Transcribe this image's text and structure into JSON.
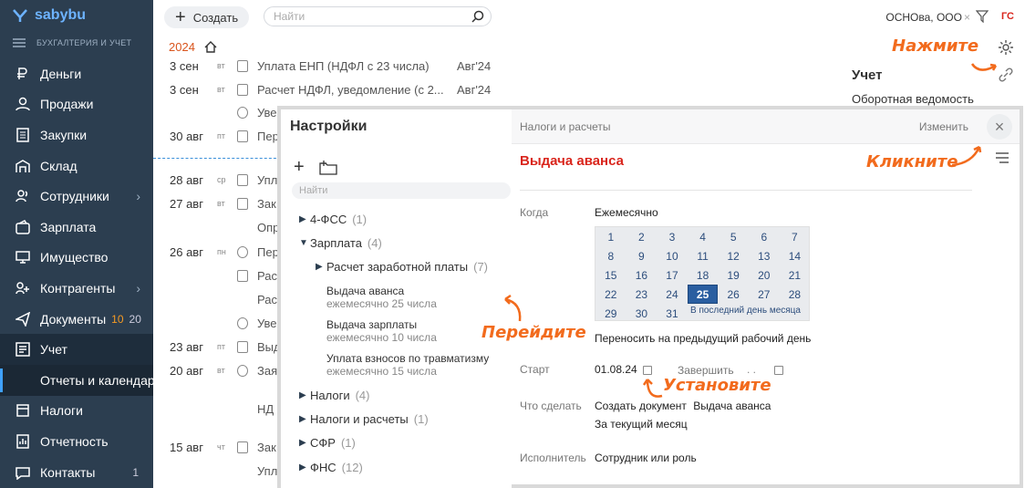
{
  "app": {
    "logo_text": "sabybu",
    "section": "БУХГАЛТЕРИЯ И УЧЕТ"
  },
  "nav": [
    {
      "label": "Деньги",
      "icon": "ruble-icon"
    },
    {
      "label": "Продажи",
      "icon": "user-icon"
    },
    {
      "label": "Закупки",
      "icon": "document-icon"
    },
    {
      "label": "Склад",
      "icon": "warehouse-icon"
    },
    {
      "label": "Сотрудники",
      "icon": "staff-icon",
      "arrow": "›"
    },
    {
      "label": "Зарплата",
      "icon": "wallet-icon"
    },
    {
      "label": "Имущество",
      "icon": "monitor-icon"
    },
    {
      "label": "Контрагенты",
      "icon": "contragents-icon",
      "arrow": "›"
    },
    {
      "label": "Документы",
      "icon": "send-icon",
      "count1": "10",
      "count2": "20"
    },
    {
      "label": "Учет",
      "icon": "accounting-icon"
    },
    {
      "label": "Отчеты и календарь"
    },
    {
      "label": "Налоги",
      "icon": "taxes-icon"
    },
    {
      "label": "Отчетность",
      "icon": "reporting-icon"
    },
    {
      "label": "Контакты",
      "icon": "contacts-icon",
      "count": "1"
    }
  ],
  "topbar": {
    "create_label": "Создать",
    "search_placeholder": "Найти",
    "org": "ОСНОва, ООО",
    "user": "ГС"
  },
  "year": "2024",
  "hints": {
    "press": "Нажмите",
    "click": "Кликните",
    "go": "Перейдите",
    "set": "Установите"
  },
  "feed": [
    {
      "d": "3 сен",
      "w": "вт",
      "t": "Уплата ЕНП (НДФЛ с 23 числа)",
      "m": "Авг'24"
    },
    {
      "d": "3 сен",
      "w": "вт",
      "t": "Расчет НДФЛ, уведомление (с 2...",
      "m": "Авг'24"
    },
    {
      "d": "",
      "w": "",
      "t": "Уве"
    },
    {
      "d": "30 авг",
      "w": "пт",
      "t": "Пер"
    },
    {
      "d": "28 авг",
      "w": "ср",
      "t": "Упл"
    },
    {
      "d": "27 авг",
      "w": "вт",
      "t": "Зак"
    },
    {
      "d": "",
      "w": "",
      "t": "Опр"
    },
    {
      "d": "26 авг",
      "w": "пн",
      "t": "Пер"
    },
    {
      "d": "",
      "w": "",
      "t": "Рас"
    },
    {
      "d": "",
      "w": "",
      "t": "Рас"
    },
    {
      "d": "",
      "w": "",
      "t": "Уве"
    },
    {
      "d": "23 авг",
      "w": "пт",
      "t": "Выд"
    },
    {
      "d": "20 авг",
      "w": "вт",
      "t": "Зая"
    },
    {
      "d": "",
      "w": "",
      "t": "НД"
    },
    {
      "d": "15 авг",
      "w": "чт",
      "t": "Зак"
    },
    {
      "d": "",
      "w": "",
      "t": "Упл"
    }
  ],
  "right_panel": {
    "title": "Учет",
    "sub": "Оборотная ведомость"
  },
  "settings": {
    "title": "Настройки",
    "search_placeholder": "Найти",
    "tree": [
      {
        "label": "4-ФСС",
        "count": "(1)"
      },
      {
        "label": "Зарплата",
        "count": "(4)"
      },
      {
        "label": "Расчет заработной платы",
        "count": "(7)"
      }
    ],
    "items": [
      {
        "title": "Выдача аванса",
        "sub": "ежемесячно 25 числа"
      },
      {
        "title": "Выдача зарплаты",
        "sub": "ежемесячно 10 числа"
      },
      {
        "title": "Уплата взносов по травматизму",
        "sub": "ежемесячно 15 числа"
      }
    ],
    "tree2": [
      {
        "label": "Налоги",
        "count": "(4)"
      },
      {
        "label": "Налоги и расчеты",
        "count": "(1)"
      },
      {
        "label": "СФР",
        "count": "(1)"
      },
      {
        "label": "ФНС",
        "count": "(12)"
      }
    ]
  },
  "detail": {
    "breadcrumb": "Налоги и расчеты",
    "edit": "Изменить",
    "title": "Выдача аванса",
    "when_label": "Когда",
    "when_value": "Ежемесячно",
    "days": [
      "1",
      "2",
      "3",
      "4",
      "5",
      "6",
      "7",
      "8",
      "9",
      "10",
      "11",
      "12",
      "13",
      "14",
      "15",
      "16",
      "17",
      "18",
      "19",
      "20",
      "21",
      "22",
      "23",
      "24",
      "25",
      "26",
      "27",
      "28",
      "29",
      "30",
      "31"
    ],
    "selected_day": "25",
    "last_day": "В последний день месяца",
    "transfer": "Переносить на предыдущий рабочий день",
    "start_label": "Старт",
    "start_value": "01.08.24",
    "finish_label": "Завершить",
    "finish_value": ". .",
    "todo_label": "Что сделать",
    "todo_value": "Создать документ",
    "todo_doc": "Выдача аванса",
    "todo_period": "За текущий месяц",
    "exec_label": "Исполнитель",
    "exec_value": "Сотрудник или роль"
  }
}
